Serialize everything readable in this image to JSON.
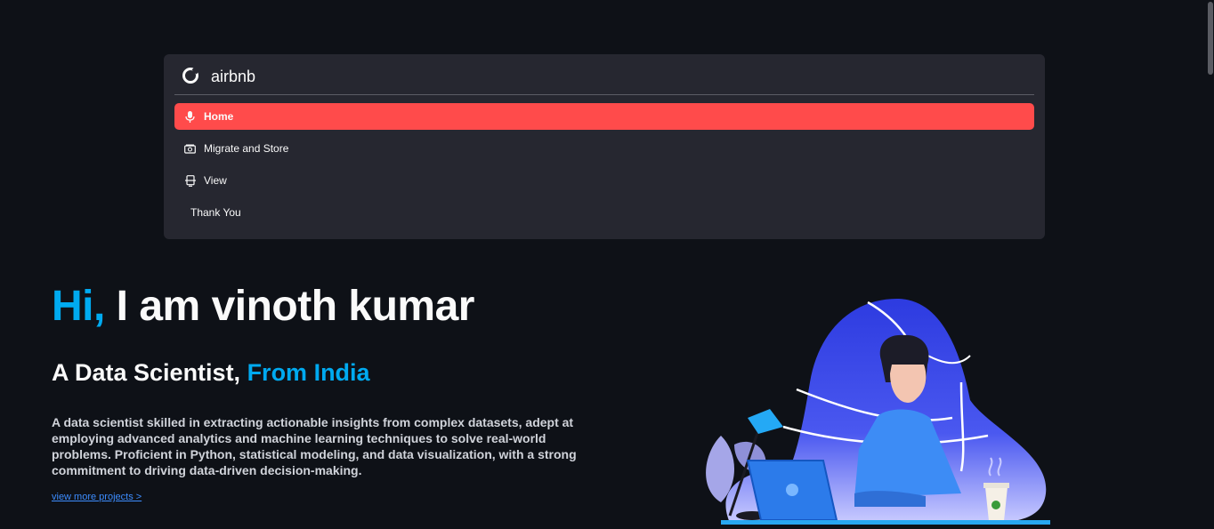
{
  "menu": {
    "title": "airbnb",
    "items": [
      {
        "label": "Home",
        "icon": "microphone-icon",
        "active": true
      },
      {
        "label": "Migrate and Store",
        "icon": "camera-box-icon",
        "active": false
      },
      {
        "label": "View",
        "icon": "device-icon",
        "active": false
      },
      {
        "label": "Thank You",
        "icon": "",
        "active": false
      }
    ]
  },
  "hero": {
    "greeting": "Hi,",
    "name": " I am vinoth kumar",
    "subtitle_prefix": "A Data Scientist, ",
    "subtitle_accent": "From India",
    "description": "A data scientist skilled in extracting actionable insights from complex datasets, adept at employing advanced analytics and machine learning techniques to solve real-world problems. Proficient in Python, statistical modeling, and data visualization, with a strong commitment to driving data-driven decision-making.",
    "link": "view more projects >"
  },
  "colors": {
    "background": "#0e1117",
    "card": "#262730",
    "active": "#ff4b4b",
    "accent": "#00aaf0",
    "link": "#3d8dff"
  }
}
